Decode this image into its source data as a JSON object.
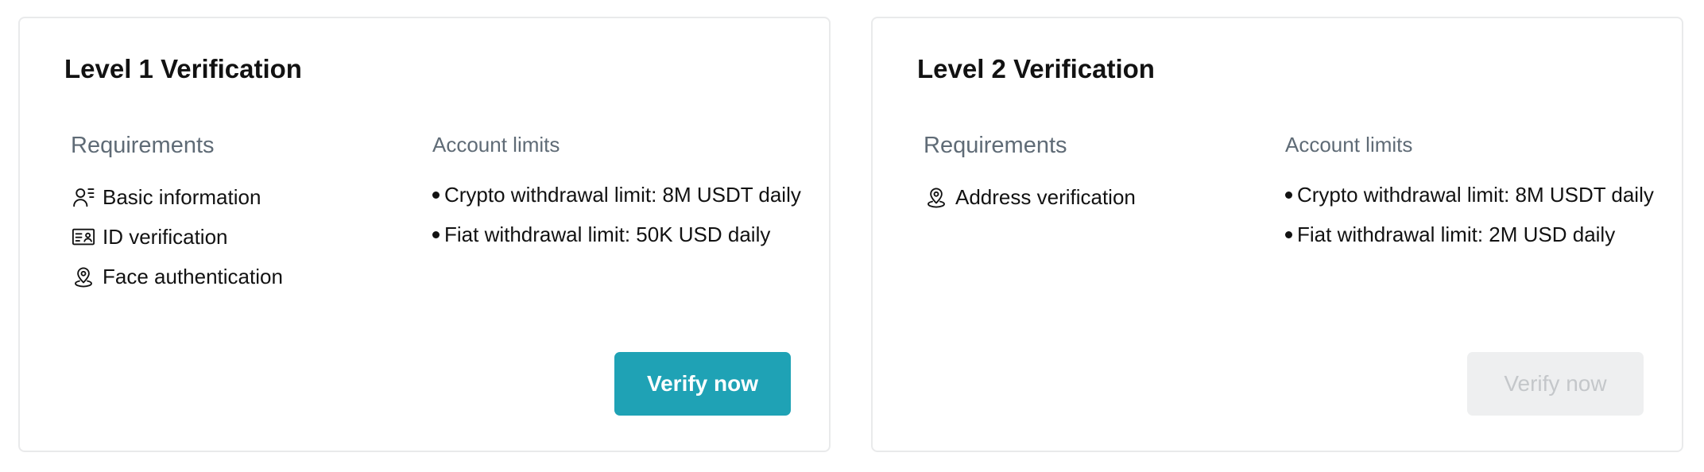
{
  "cards": [
    {
      "title": "Level 1 Verification",
      "requirements_heading": "Requirements",
      "requirements": [
        {
          "label": "Basic information",
          "icon": "user-id-icon"
        },
        {
          "label": "ID verification",
          "icon": "id-card-icon"
        },
        {
          "label": "Face authentication",
          "icon": "location-pin-icon"
        }
      ],
      "limits_heading": "Account limits",
      "limits": [
        "Crypto withdrawal limit: 8M USDT daily",
        "Fiat withdrawal limit: 50K USD daily"
      ],
      "button_label": "Verify now",
      "button_state": "enabled"
    },
    {
      "title": "Level 2 Verification",
      "requirements_heading": "Requirements",
      "requirements": [
        {
          "label": "Address verification",
          "icon": "location-pin-icon"
        }
      ],
      "limits_heading": "Account limits",
      "limits": [
        "Crypto withdrawal limit: 8M USDT daily",
        "Fiat withdrawal limit: 2M USD daily"
      ],
      "button_label": "Verify now",
      "button_state": "disabled"
    }
  ],
  "colors": {
    "accent": "#1fa2b5",
    "muted_text": "#5f6b76",
    "disabled_bg": "#eeeff0",
    "disabled_text": "#c4c7ca",
    "border": "#e9eaeb"
  }
}
